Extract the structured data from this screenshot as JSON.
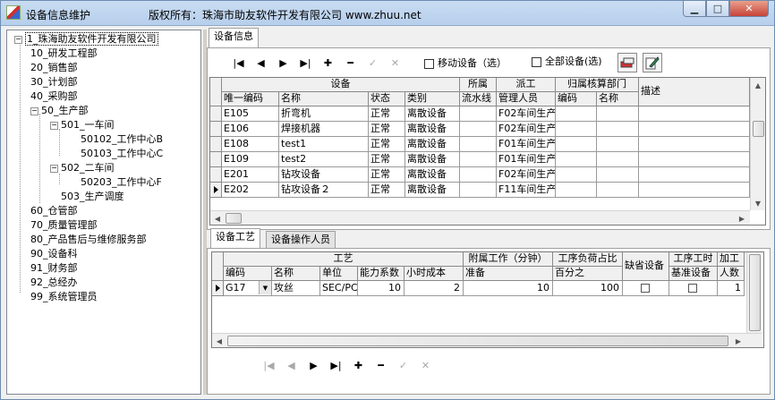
{
  "window": {
    "title": "设备信息维护",
    "copyright": "版权所有：珠海市助友软件开发有限公司 www.zhuu.net",
    "minimize_glyph": "▁",
    "maximize_glyph": "□",
    "close_glyph": "✕"
  },
  "tree": {
    "items": [
      {
        "label": "1_珠海助友软件开发有限公司",
        "toggle": "−"
      },
      {
        "label": "10_研发工程部"
      },
      {
        "label": "20_销售部"
      },
      {
        "label": "30_计划部"
      },
      {
        "label": "40_采购部"
      },
      {
        "label": "50_生产部",
        "toggle": "−"
      },
      {
        "label": "501_一车间",
        "toggle": "−"
      },
      {
        "label": "50102_工作中心B"
      },
      {
        "label": "50103_工作中心C"
      },
      {
        "label": "502_二车间",
        "toggle": "−"
      },
      {
        "label": "50203_工作中心F"
      },
      {
        "label": "503_生产调度"
      },
      {
        "label": "60_仓管部"
      },
      {
        "label": "70_质量管理部"
      },
      {
        "label": "80_产品售后与维修服务部"
      },
      {
        "label": "90_设备科"
      },
      {
        "label": "91_财务部"
      },
      {
        "label": "92_总经办"
      },
      {
        "label": "99_系统管理员"
      }
    ]
  },
  "main_tab": {
    "label": "设备信息"
  },
  "toolbar_top": {
    "first": "|◀",
    "prev": "◀",
    "next": "▶",
    "last": "▶|",
    "add": "✚",
    "remove": "━",
    "confirm": "✓",
    "cancel": "✕"
  },
  "filters": {
    "mobile_label": "移动设备（选）",
    "all_label": "全部设备(选)"
  },
  "equipment_grid": {
    "group_headers": {
      "equipment": "设备",
      "belong": "所属",
      "dispatch": "派工",
      "account_dept": "归属核算部门",
      "description": "描述"
    },
    "columns": {
      "code": "唯一编码",
      "name": "名称",
      "status": "状态",
      "category": "类别",
      "line": "流水线",
      "manager": "管理人员",
      "dept_code": "编码",
      "dept_name": "名称"
    },
    "rows": [
      {
        "code": "E105",
        "name": "折弯机",
        "status": "正常",
        "category": "离散设备",
        "line": "",
        "manager": "F02车间生产",
        "dept_code": "",
        "dept_name": ""
      },
      {
        "code": "E106",
        "name": "焊接机器",
        "status": "正常",
        "category": "离散设备",
        "line": "",
        "manager": "F02车间生产",
        "dept_code": "",
        "dept_name": ""
      },
      {
        "code": "E108",
        "name": "test1",
        "status": "正常",
        "category": "离散设备",
        "line": "",
        "manager": "F01车间生产",
        "dept_code": "",
        "dept_name": ""
      },
      {
        "code": "E109",
        "name": "test2",
        "status": "正常",
        "category": "离散设备",
        "line": "",
        "manager": "F01车间生产",
        "dept_code": "",
        "dept_name": ""
      },
      {
        "code": "E201",
        "name": "钻攻设备",
        "status": "正常",
        "category": "离散设备",
        "line": "",
        "manager": "F02车间生产",
        "dept_code": "",
        "dept_name": ""
      },
      {
        "code": "E202",
        "name": "钻攻设备２",
        "status": "正常",
        "category": "离散设备",
        "line": "",
        "manager": "F11车间生产",
        "dept_code": "",
        "dept_name": ""
      }
    ]
  },
  "sub_tabs": {
    "process": "设备工艺",
    "operators": "设备操作人员"
  },
  "process_grid": {
    "group_headers": {
      "process": "工艺",
      "attached": "附属工作（分钟）",
      "load": "工序负荷占比",
      "default": "缺省设备",
      "std": "工序工时",
      "add": "加工"
    },
    "columns": {
      "code": "编码",
      "name": "名称",
      "unit": "单位",
      "capacity": "能力系数",
      "hour_cost": "小时成本",
      "prepare": "准备",
      "percent": "百分之",
      "default_dev": "",
      "std_dev": "基准设备",
      "workers": "人数"
    },
    "rows": [
      {
        "code": "G17",
        "name": "攻丝",
        "unit": "SEC/PC",
        "capacity": "10",
        "hour_cost": "2",
        "prepare": "10",
        "percent": "100",
        "workers": "1"
      }
    ]
  },
  "toolbar_bottom": {
    "first": "|◀",
    "prev": "◀",
    "next": "▶",
    "last": "▶|",
    "add": "✚",
    "remove": "━",
    "confirm": "✓",
    "cancel": "✕"
  }
}
